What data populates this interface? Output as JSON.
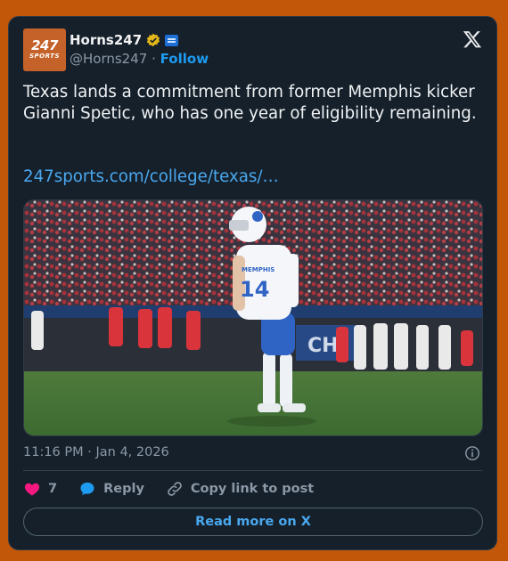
{
  "author": {
    "name": "Horns247",
    "handle": "@Horns247",
    "separator": "·",
    "follow_label": "Follow",
    "avatar_line1": "247",
    "avatar_line2": "SPORTS"
  },
  "tweet": {
    "text": "Texas lands a commitment from former Memphis kicker Gianni Spetic, who has one year of eligibility remaining.",
    "link": "247sports.com/college/texas/…",
    "timestamp": "11:16 PM · Jan 4, 2026",
    "jersey_number": "14",
    "jersey_text": "MEMPHIS"
  },
  "actions": {
    "like_count": "7",
    "reply_label": "Reply",
    "copy_label": "Copy link to post"
  },
  "read_more_label": "Read more on X",
  "colors": {
    "page_background": "#c2570a",
    "card_background": "#15202b",
    "accent_blue": "#1d9bf0",
    "like_pink": "#f91880",
    "verified_gold": "#e2b719"
  }
}
